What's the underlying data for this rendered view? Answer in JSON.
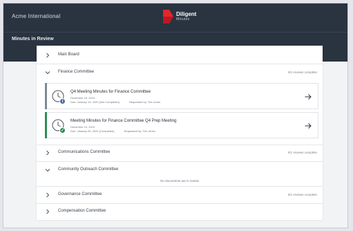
{
  "header": {
    "org_name": "Acme International",
    "logo_title": "Diligent",
    "logo_subtitle": "Minutes",
    "page_title": "Minutes in Review"
  },
  "committees": [
    {
      "name": "Main Board",
      "expanded": false,
      "count": ""
    },
    {
      "name": "Finance Committee",
      "expanded": true,
      "count": "0/2 reviews complete"
    },
    {
      "name": "Communications Committee",
      "expanded": false,
      "count": "0/1 reviews complete"
    },
    {
      "name": "Community Outreach Committee",
      "expanded": true,
      "count": "",
      "empty_message": "No documents are in review"
    },
    {
      "name": "Governance Committee",
      "expanded": false,
      "count": "0/1 reviews complete"
    },
    {
      "name": "Compensation Committee",
      "expanded": false,
      "count": ""
    }
  ],
  "documents": [
    {
      "title": "Q4 Meeting Minutes for Finance Committee",
      "date": "December 16, 2019",
      "due": "Due: January 15, 2020 (Not Completed)",
      "requester": "Requested by: Tim Jones",
      "status": "pending",
      "status_glyph": "i",
      "accent_color": "#7f8896",
      "status_color": "#4a6fa5"
    },
    {
      "title": "Meeting Minutes for Finance Committee Q4 Prep Meeting",
      "date": "December 19, 2019",
      "due": "Due: January 25, 2020 (Completed)",
      "requester": "Requested by: Tim Jones",
      "status": "complete",
      "status_glyph": "✓",
      "accent_color": "#2e8b57",
      "status_color": "#2e8b57"
    }
  ],
  "colors": {
    "header_bg": "#2a3340",
    "brand_red": "#e3262b"
  },
  "icons": {
    "collapsed": "chevron-right-icon",
    "expanded": "chevron-down-icon",
    "document": "document-clock-icon",
    "open": "arrow-right-icon"
  }
}
